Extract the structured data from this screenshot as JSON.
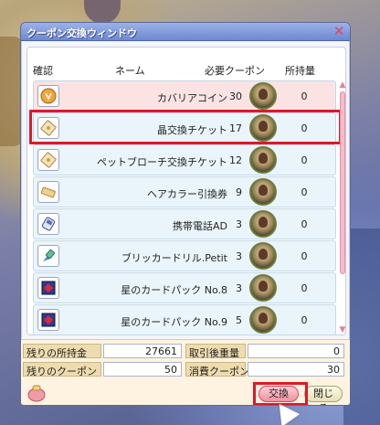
{
  "window": {
    "title": "クーポン交換ウィンドウ",
    "close_glyph": "✕"
  },
  "table": {
    "headers": {
      "confirm": "確認",
      "name": "ネーム",
      "required": "必要クーポン",
      "owned": "所持量"
    },
    "items": [
      {
        "name": "カバリアコイン",
        "required": "30",
        "owned": "0",
        "icon": "coin-icon",
        "selected": true
      },
      {
        "name": "晶交換チケット",
        "required": "17",
        "owned": "0",
        "icon": "ticket-icon",
        "selected": false
      },
      {
        "name": "ペットブローチ交換チケット",
        "required": "12",
        "owned": "0",
        "icon": "ticket-icon",
        "selected": false
      },
      {
        "name": "ヘアカラー引換券",
        "required": "9",
        "owned": "0",
        "icon": "voucher-icon",
        "selected": false
      },
      {
        "name": "携帯電話AD",
        "required": "3",
        "owned": "0",
        "icon": "phone-icon",
        "selected": false
      },
      {
        "name": "ブリッカードリル.Petit",
        "required": "3",
        "owned": "0",
        "icon": "drill-icon",
        "selected": false
      },
      {
        "name": "星のカードパック No.8",
        "required": "3",
        "owned": "0",
        "icon": "card-pack-icon",
        "selected": false
      },
      {
        "name": "星のカードパック No.9",
        "required": "5",
        "owned": "0",
        "icon": "card-pack-icon",
        "selected": false
      }
    ]
  },
  "footer": {
    "held_amount_label": "残りの所持金",
    "held_amount_value": "27661",
    "trade_weight_label": "取引後重量",
    "trade_weight_value": "0",
    "remaining_coupons_label": "残りのクーポン",
    "remaining_coupons_value": "50",
    "consumed_coupons_label": "消費クーポン",
    "consumed_coupons_value": "30"
  },
  "buttons": {
    "exchange": "交換",
    "close": "閉じる"
  },
  "colors": {
    "highlight": "#e0172a",
    "title_bar": "#7e96d9",
    "selected_row": "#fbe3e4",
    "row": "#eaf5fb"
  }
}
